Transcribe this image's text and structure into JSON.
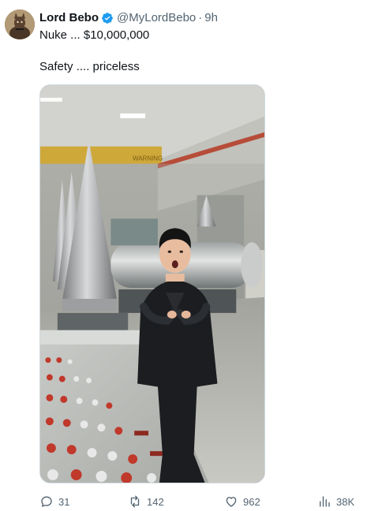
{
  "author": {
    "display_name": "Lord Bebo",
    "handle": "@MyLordBebo",
    "separator": "·",
    "time": "9h",
    "verified": true,
    "verified_color": "#1d9bf0"
  },
  "tweet": {
    "line1": "Nuke ... $10,000,000",
    "line2": "Safety .... priceless"
  },
  "media": {
    "type": "video",
    "sign_text": "WARNING"
  },
  "actions": {
    "replies": "31",
    "reposts": "142",
    "likes": "962",
    "views": "38K"
  },
  "colors": {
    "text_primary": "#0f1419",
    "text_secondary": "#536471",
    "accent": "#1d9bf0"
  },
  "icons": [
    "reply-icon",
    "repost-icon",
    "like-icon",
    "views-icon",
    "verified-icon"
  ]
}
